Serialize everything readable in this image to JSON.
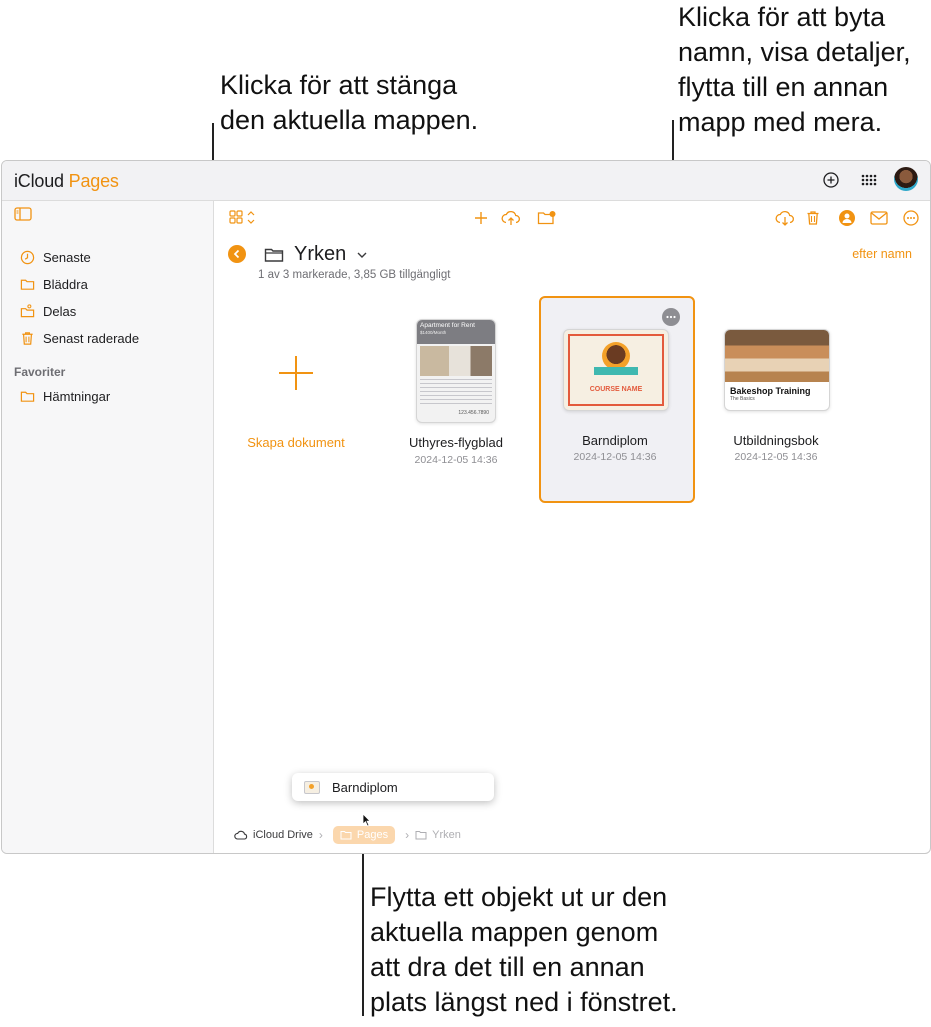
{
  "callouts": {
    "close_folder": "Klicka för att stänga\nden aktuella mappen.",
    "rename": "Klicka för att byta\nnamn, visa detaljer,\nflytta till en annan\nmapp med mera.",
    "move": "Flytta ett objekt ut ur den\naktuella mappen genom\natt dra det till en annan\nplats längst ned i fönstret."
  },
  "app": {
    "apple": "",
    "brand": "iCloud",
    "product": "Pages"
  },
  "sidebar": {
    "items": [
      {
        "label": "Senaste",
        "icon": "clock-icon"
      },
      {
        "label": "Bläddra",
        "icon": "folder-icon"
      },
      {
        "label": "Delas",
        "icon": "shared-folder-icon"
      },
      {
        "label": "Senast raderade",
        "icon": "trash-icon"
      }
    ],
    "favorites_heading": "Favoriter",
    "favorites": [
      {
        "label": "Hämtningar",
        "icon": "folder-icon"
      }
    ]
  },
  "folder": {
    "title": "Yrken",
    "info": "1 av 3 markerade, 3,85 GB tillgängligt",
    "sort": "efter namn"
  },
  "create": {
    "label": "Skapa dokument"
  },
  "documents": [
    {
      "name": "Uthyres-flygblad",
      "date": "2024-12-05 14:36",
      "thumb_title": "Apartment for Rent",
      "thumb_sub": "$1400/Month",
      "thumb_phone": "123.456.7890"
    },
    {
      "name": "Barndiplom",
      "date": "2024-12-05 14:36",
      "thumb_title": "COURSE NAME",
      "selected": true
    },
    {
      "name": "Utbildningsbok",
      "date": "2024-12-05 14:36",
      "thumb_title": "Bakeshop Training",
      "thumb_sub": "The Basics"
    }
  ],
  "drag": {
    "label": "Barndiplom"
  },
  "breadcrumbs": [
    {
      "label": "iCloud Drive",
      "icon": "cloud-icon"
    },
    {
      "label": "Pages",
      "icon": "folder-icon"
    },
    {
      "label": "Yrken",
      "icon": "folder-icon"
    }
  ],
  "colors": {
    "accent": "#f19312",
    "selection": "#f0f0f4"
  }
}
